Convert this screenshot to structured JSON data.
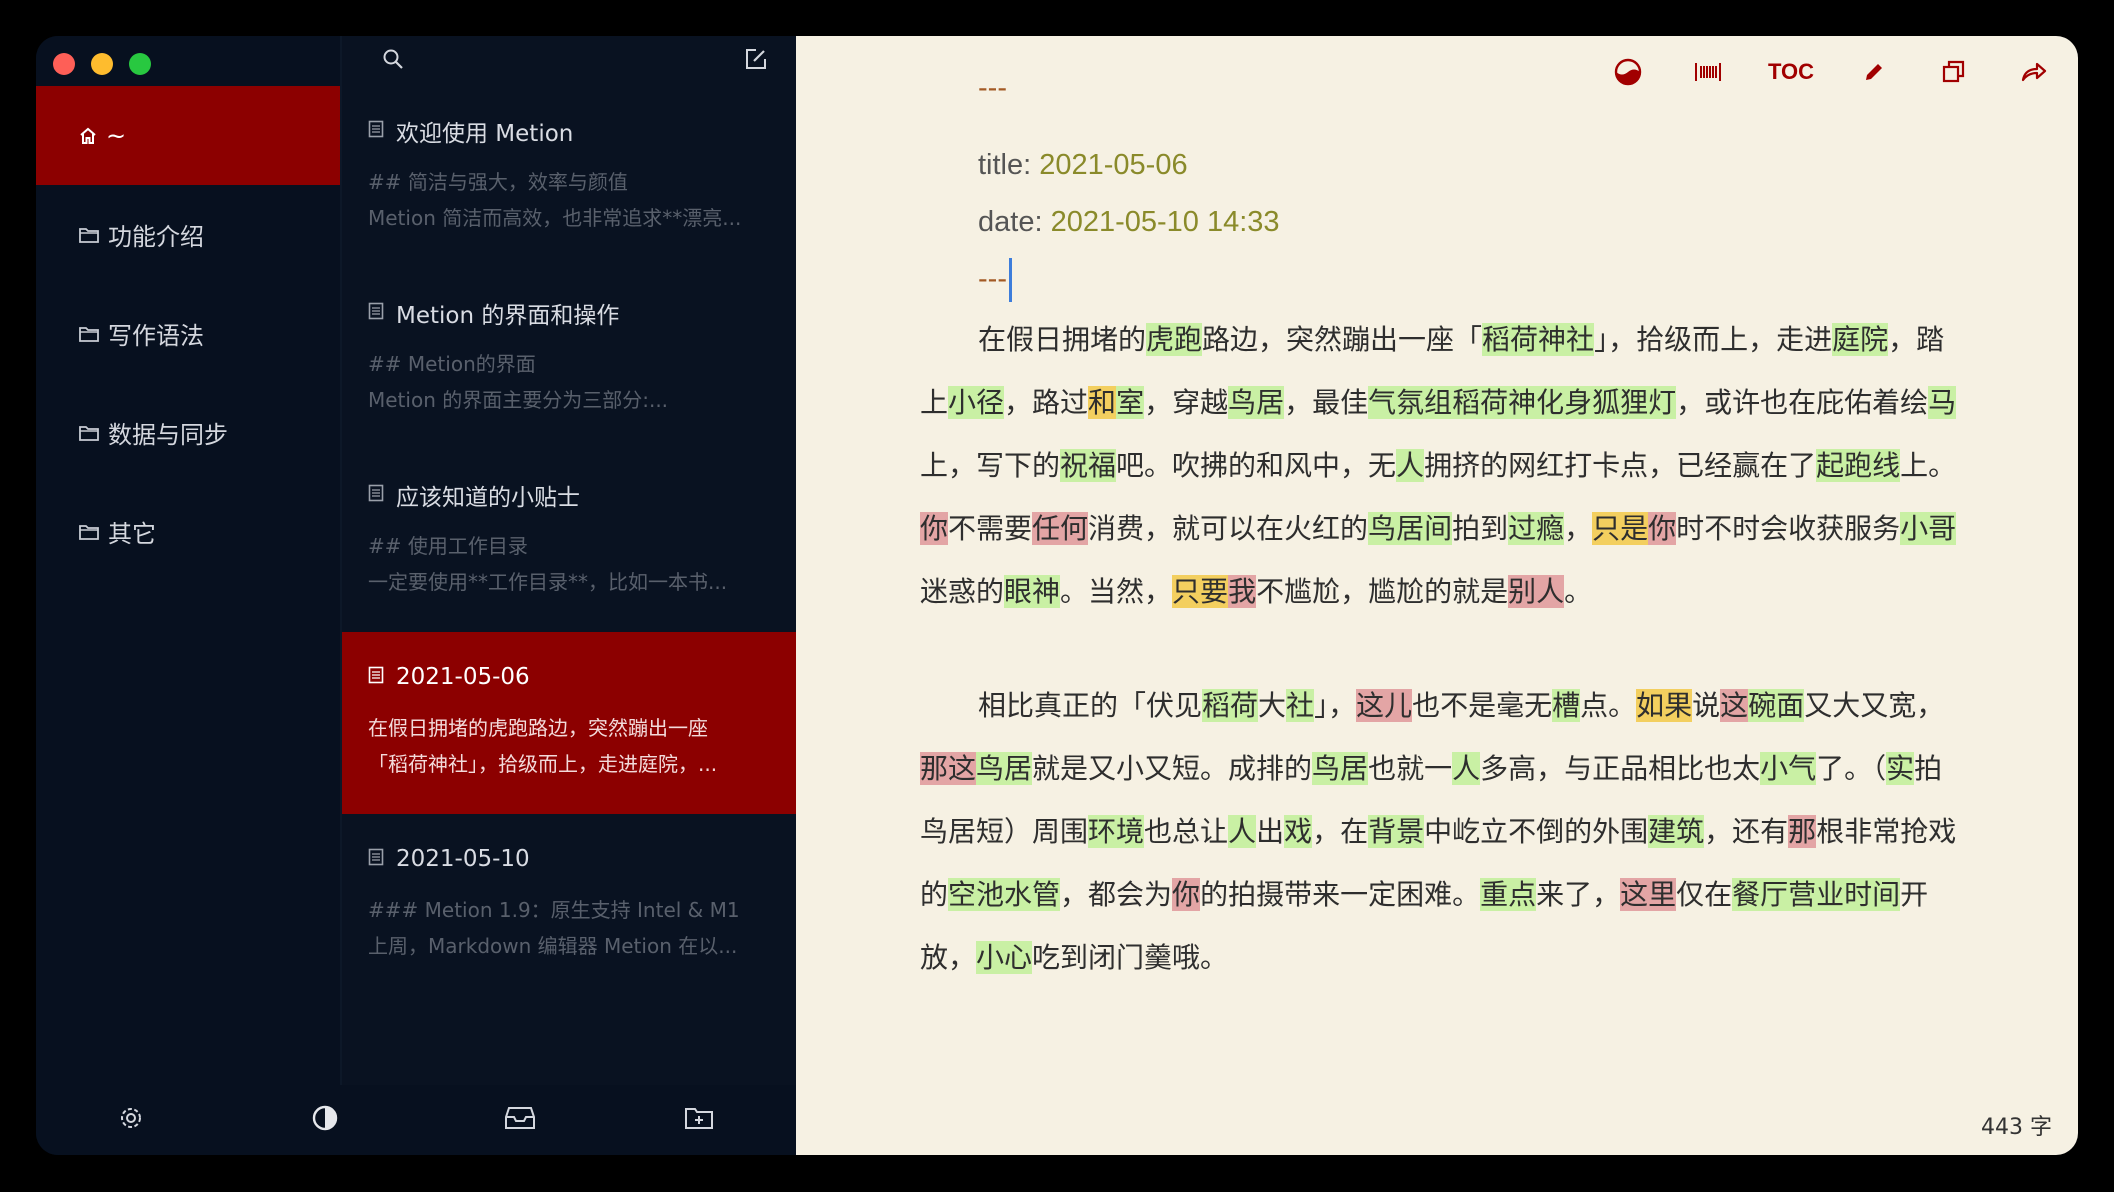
{
  "sidebar": {
    "items": [
      {
        "label": "~",
        "icon": "home-icon"
      },
      {
        "label": "功能介绍",
        "icon": "folder-icon"
      },
      {
        "label": "写作语法",
        "icon": "folder-icon"
      },
      {
        "label": "数据与同步",
        "icon": "folder-icon"
      },
      {
        "label": "其它",
        "icon": "folder-icon"
      }
    ]
  },
  "notes": [
    {
      "title": "欢迎使用 Metion",
      "line1": "## 简洁与强大，效率与颜值",
      "line2": "Metion 简洁而高效，也非常追求**漂亮..."
    },
    {
      "title": "Metion 的界面和操作",
      "line1": "## Metion的界面",
      "line2": "Metion 的界面主要分为三部分:..."
    },
    {
      "title": "应该知道的小贴士",
      "line1": "## 使用工作目录",
      "line2": "一定要使用**工作目录**，比如一本书..."
    },
    {
      "title": "2021-05-06",
      "line1": "在假日拥堵的虎跑路边，突然蹦出一座",
      "line2": "「稻荷神社」，拾级而上，走进庭院，..."
    },
    {
      "title": "2021-05-10",
      "line1": "### Metion 1.9：原生支持 Intel & M1",
      "line2": "上周，Markdown 编辑器 Metion 在以..."
    }
  ],
  "toolbar": {
    "toc_label": "TOC"
  },
  "editor": {
    "fm_dash": "---",
    "title_key": "title:",
    "title_value": "2021-05-06",
    "date_key": "date:",
    "date_value": "2021-05-10 14:33",
    "word_count": "443 字"
  },
  "paragraphs": [
    [
      [
        "在假日拥堵的",
        ""
      ],
      [
        "虎跑",
        "g"
      ],
      [
        "路边，突然蹦出一座「",
        ""
      ],
      [
        "稻荷神社",
        "g"
      ],
      [
        "」，拾级而上，走进",
        ""
      ],
      [
        "庭院",
        "g"
      ],
      [
        "，踏上",
        ""
      ],
      [
        "小径",
        "g"
      ],
      [
        "，路过",
        ""
      ],
      [
        "和",
        "y"
      ],
      [
        "室",
        "g"
      ],
      [
        "，穿越",
        ""
      ],
      [
        "鸟居",
        "g"
      ],
      [
        "，最佳",
        ""
      ],
      [
        "气氛组稻荷神化身狐狸灯",
        "g"
      ],
      [
        "，或许也在庇佑着绘",
        ""
      ],
      [
        "马",
        "g"
      ],
      [
        "上，写下的",
        ""
      ],
      [
        "祝福",
        "g"
      ],
      [
        "吧。吹拂的和风中，无",
        ""
      ],
      [
        "人",
        "g"
      ],
      [
        "拥挤的网红打卡点，已经赢在了",
        ""
      ],
      [
        "起跑线",
        "g"
      ],
      [
        "上。",
        ""
      ],
      [
        "你",
        "r"
      ],
      [
        "不需要",
        ""
      ],
      [
        "任何",
        "r"
      ],
      [
        "消费，就可以在火红的",
        ""
      ],
      [
        "鸟居间",
        "g"
      ],
      [
        "拍到",
        ""
      ],
      [
        "过瘾",
        "g"
      ],
      [
        "，",
        ""
      ],
      [
        "只是",
        "y"
      ],
      [
        "你",
        "r"
      ],
      [
        "时不时会收获服务",
        ""
      ],
      [
        "小哥",
        "g"
      ],
      [
        "迷惑的",
        ""
      ],
      [
        "眼神",
        "g"
      ],
      [
        "。当然，",
        ""
      ],
      [
        "只要",
        "y"
      ],
      [
        "我",
        "r"
      ],
      [
        "不尴尬，尴尬的就是",
        ""
      ],
      [
        "别人",
        "r"
      ],
      [
        "。",
        ""
      ]
    ],
    [
      [
        "相比真正的「伏见",
        ""
      ],
      [
        "稻荷",
        "g"
      ],
      [
        "大",
        ""
      ],
      [
        "社",
        "g"
      ],
      [
        "」，",
        ""
      ],
      [
        "这儿",
        "r"
      ],
      [
        "也不是毫无",
        ""
      ],
      [
        "槽",
        "g"
      ],
      [
        "点。",
        ""
      ],
      [
        "如果",
        "y"
      ],
      [
        "说",
        ""
      ],
      [
        "这",
        "r"
      ],
      [
        "碗面",
        "g"
      ],
      [
        "又大又宽，",
        ""
      ],
      [
        "那这",
        "r"
      ],
      [
        "鸟居",
        "g"
      ],
      [
        "就是又小又短。成排的",
        ""
      ],
      [
        "鸟居",
        "g"
      ],
      [
        "也就一",
        ""
      ],
      [
        "人",
        "g"
      ],
      [
        "多高，与正品相比也太",
        ""
      ],
      [
        "小气",
        "g"
      ],
      [
        "了。（",
        ""
      ],
      [
        "实",
        "g"
      ],
      [
        "拍鸟居短）周围",
        ""
      ],
      [
        "环境",
        "g"
      ],
      [
        "也总让",
        ""
      ],
      [
        "人",
        "g"
      ],
      [
        "出",
        ""
      ],
      [
        "戏",
        "g"
      ],
      [
        "，在",
        ""
      ],
      [
        "背景",
        "g"
      ],
      [
        "中屹立不倒的外围",
        ""
      ],
      [
        "建筑",
        "g"
      ],
      [
        "，还有",
        ""
      ],
      [
        "那",
        "r"
      ],
      [
        "根非常抢戏的",
        ""
      ],
      [
        "空池水管",
        "g"
      ],
      [
        "，都会为",
        ""
      ],
      [
        "你",
        "r"
      ],
      [
        "的拍摄带来一定困难。",
        ""
      ],
      [
        "重点",
        "g"
      ],
      [
        "来了，",
        ""
      ],
      [
        "这里",
        "r"
      ],
      [
        "仅在",
        ""
      ],
      [
        "餐厅营业时间",
        "g"
      ],
      [
        "开放，",
        ""
      ],
      [
        "小心",
        "g"
      ],
      [
        "吃到闭门羹哦。",
        ""
      ]
    ]
  ],
  "colors": {
    "accent": "#8c0000",
    "highlight_green": "#c9f0a4",
    "highlight_yellow": "#f3cf5f",
    "highlight_red": "#e3a5a5"
  }
}
